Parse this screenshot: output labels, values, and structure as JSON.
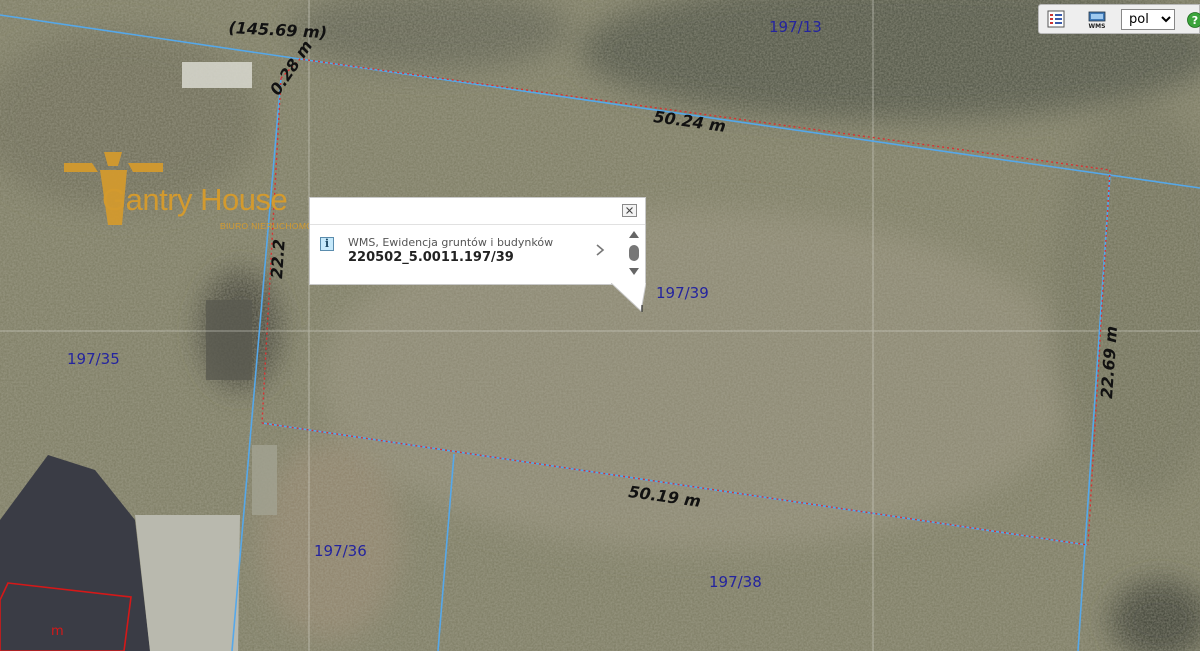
{
  "map": {
    "parcels": [
      {
        "id": "197/13",
        "label": "197/13"
      },
      {
        "id": "197/39",
        "label": "197/39"
      },
      {
        "id": "197/35",
        "label": "197/35"
      },
      {
        "id": "197/36",
        "label": "197/36"
      },
      {
        "id": "197/38",
        "label": "197/38"
      }
    ],
    "dimensions": {
      "top_overall": "(145.69 m)",
      "offset": "0.28 m",
      "top": "50.24 m",
      "left": "22.2",
      "right": "22.69 m",
      "bottom": "50.19 m"
    },
    "marker_letter": "m",
    "colors": {
      "parcel_boundary": "#55a8ea",
      "measured_edge": "#d63232",
      "parcel_label": "#24249e",
      "marker": "#d51818"
    }
  },
  "watermark": {
    "brand": "Gantry House",
    "subtitle": "BIURO NIERUCHOMOŚCI",
    "color": "#d39a2e"
  },
  "toolbar": {
    "legend_icon": "legend-icon",
    "wms_icon": "wms-icon",
    "wms_label": "WMS",
    "language": {
      "selected": "pol",
      "options": [
        "pol"
      ]
    },
    "help_icon": "help-icon"
  },
  "popup": {
    "source": "WMS, Ewidencja gruntów i budynków",
    "parcel_id": "220502_5.0011.197/39",
    "info_icon_glyph": "i",
    "close_icon": "close-icon",
    "next_icon": "chevron-right-icon"
  }
}
